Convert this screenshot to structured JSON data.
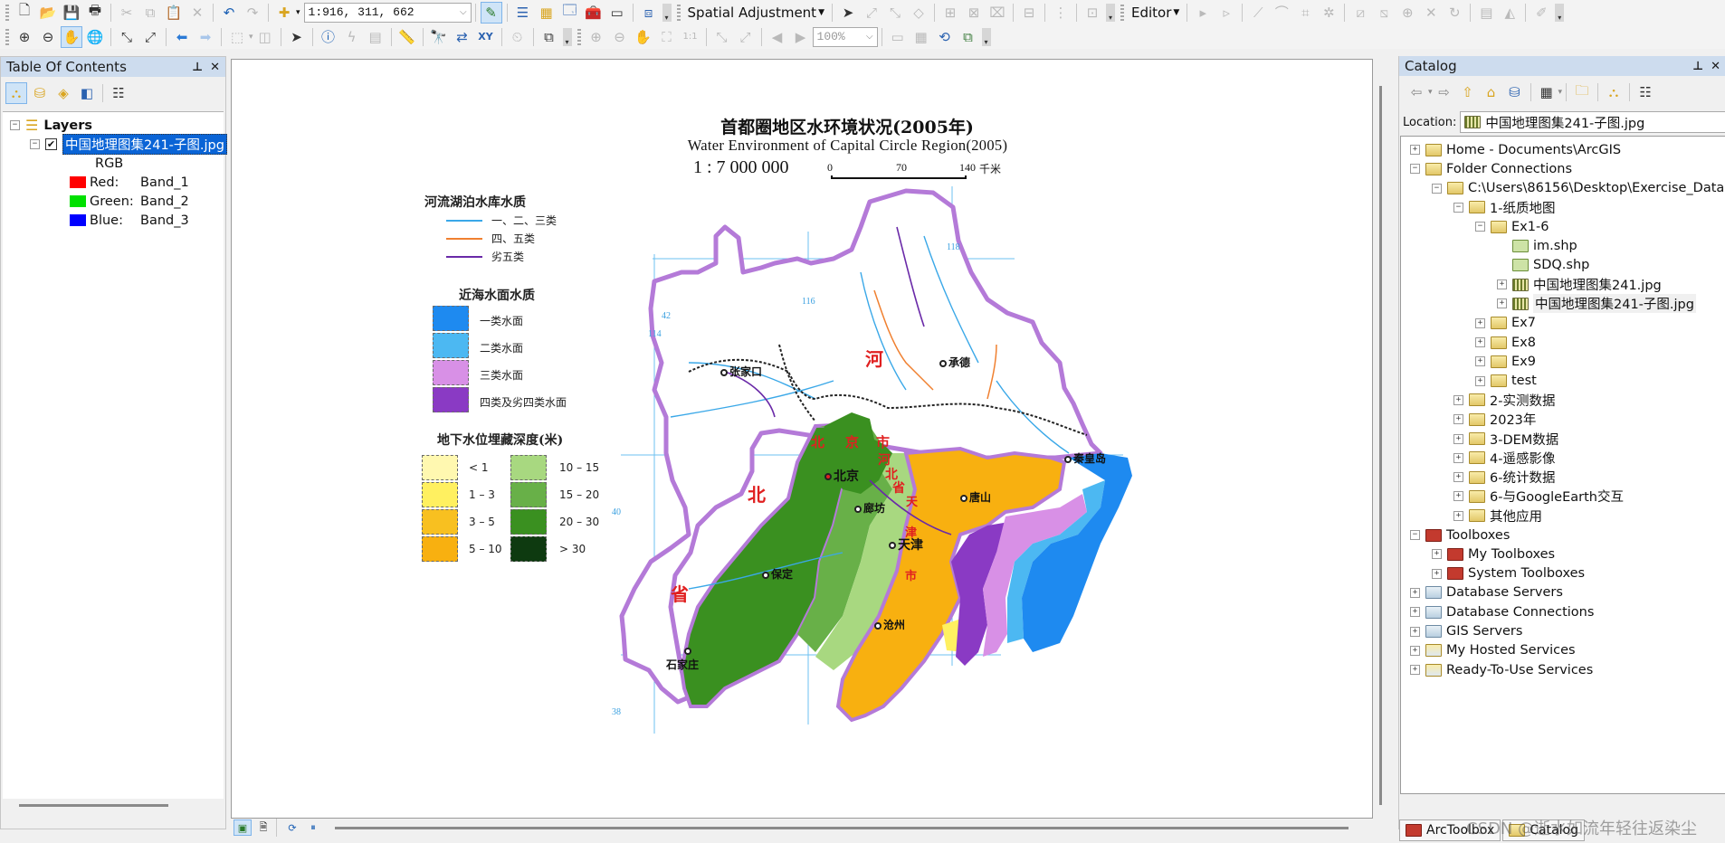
{
  "toolbar1": {
    "scale_value": "1:916, 311, 662",
    "spatial_adjustment_label": "Spatial Adjustment",
    "editor_label": "Editor",
    "icons": [
      "new-document",
      "open-folder",
      "save",
      "print",
      "cut",
      "copy",
      "paste",
      "delete",
      "undo",
      "redo",
      "add-data",
      "scale-combo",
      "editor-toolbar",
      "table-of-contents",
      "catalog",
      "search-window",
      "arctoolbox",
      "python",
      "modelbuilder"
    ]
  },
  "toolbar2": {
    "zoom_percent": "100%"
  },
  "toc": {
    "title": "Table Of Contents",
    "root_label": "Layers",
    "layer_name": "中国地理图集241-子图.jpg",
    "layer_checked": true,
    "renderer": "RGB",
    "bands": [
      {
        "label": "Red:",
        "band": "Band_1",
        "color": "#ff0000"
      },
      {
        "label": "Green:",
        "band": "Band_2",
        "color": "#00e000"
      },
      {
        "label": "Blue:",
        "band": "Band_3",
        "color": "#0000ff"
      }
    ]
  },
  "map": {
    "title_zh": "首都圈地区水环境状况(2005年)",
    "title_en": "Water Environment of Capital Circle Region(2005)",
    "scale_text": "1 : 7 000 000",
    "scalebar": {
      "ticks": [
        "0",
        "70",
        "140"
      ],
      "unit": "千米"
    },
    "legend": {
      "rivers": {
        "title": "河流湖泊水库水质",
        "items": [
          {
            "label": "一、二、三类",
            "color": "#3aa8e8"
          },
          {
            "label": "四、五类",
            "color": "#f08030"
          },
          {
            "label": "劣五类",
            "color": "#6a2aa8"
          }
        ]
      },
      "sea": {
        "title": "近海水面水质",
        "items": [
          {
            "label": "一类水面",
            "color": "#1e8af0"
          },
          {
            "label": "二类水面",
            "color": "#4cb8f2"
          },
          {
            "label": "三类水面",
            "color": "#d890e6"
          },
          {
            "label": "四类及劣四类水面",
            "color": "#8a3ac4"
          }
        ]
      },
      "groundwater": {
        "title": "地下水位埋藏深度(米)",
        "items": [
          {
            "label": "< 1",
            "color": "#fff8b0"
          },
          {
            "label": "1 – 3",
            "color": "#fff060"
          },
          {
            "label": "3 – 5",
            "color": "#f8c020"
          },
          {
            "label": "5 – 10",
            "color": "#f8b010"
          },
          {
            "label": "10 – 15",
            "color": "#a8d880"
          },
          {
            "label": "15 – 20",
            "color": "#68b048"
          },
          {
            "label": "20 – 30",
            "color": "#3a9020"
          },
          {
            "label": "> 30",
            "color": "#0e3a10"
          }
        ]
      }
    },
    "places": [
      {
        "name": "张家口"
      },
      {
        "name": "承德"
      },
      {
        "name": "北京"
      },
      {
        "name": "廊坊"
      },
      {
        "name": "唐山"
      },
      {
        "name": "秦皇岛"
      },
      {
        "name": "天津"
      },
      {
        "name": "保定"
      },
      {
        "name": "沧州"
      },
      {
        "name": "石家庄"
      }
    ],
    "region_labels": [
      "河",
      "北",
      "省",
      "北",
      "京",
      "市",
      "河",
      "北",
      "省",
      "天",
      "津",
      "市"
    ],
    "grid_labels": {
      "lon": [
        "114",
        "116",
        "118"
      ],
      "lat": [
        "38",
        "40",
        "42"
      ]
    }
  },
  "map_status": {
    "data_view_icon": "data-view",
    "layout_view_icon": "layout-view",
    "refresh_icon": "refresh",
    "pause_icon": "pause"
  },
  "catalog": {
    "title": "Catalog",
    "location_label": "Location:",
    "location_value": "中国地理图集241-子图.jpg",
    "tree": [
      {
        "level": 0,
        "expander": "+",
        "icon": "folder-home",
        "label": "Home - Documents\\ArcGIS"
      },
      {
        "level": 0,
        "expander": "-",
        "icon": "folder-connections",
        "label": "Folder Connections"
      },
      {
        "level": 1,
        "expander": "-",
        "icon": "folder",
        "label": "C:\\Users\\86156\\Desktop\\Exercise_Data"
      },
      {
        "level": 2,
        "expander": "-",
        "icon": "folder",
        "label": "1-纸质地图"
      },
      {
        "level": 3,
        "expander": "-",
        "icon": "folder",
        "label": "Ex1-6"
      },
      {
        "level": 4,
        "expander": "",
        "icon": "shapefile",
        "label": "im.shp"
      },
      {
        "level": 4,
        "expander": "",
        "icon": "shapefile",
        "label": "SDQ.shp"
      },
      {
        "level": 4,
        "expander": "+",
        "icon": "raster",
        "label": "中国地理图集241.jpg"
      },
      {
        "level": 4,
        "expander": "+",
        "icon": "raster",
        "label": "中国地理图集241-子图.jpg",
        "highlighted": true
      },
      {
        "level": 3,
        "expander": "+",
        "icon": "folder",
        "label": "Ex7"
      },
      {
        "level": 3,
        "expander": "+",
        "icon": "folder",
        "label": "Ex8"
      },
      {
        "level": 3,
        "expander": "+",
        "icon": "folder",
        "label": "Ex9"
      },
      {
        "level": 3,
        "expander": "+",
        "icon": "folder",
        "label": "test"
      },
      {
        "level": 2,
        "expander": "+",
        "icon": "folder",
        "label": "2-实测数据"
      },
      {
        "level": 2,
        "expander": "+",
        "icon": "folder",
        "label": "2023年"
      },
      {
        "level": 2,
        "expander": "+",
        "icon": "folder",
        "label": "3-DEM数据"
      },
      {
        "level": 2,
        "expander": "+",
        "icon": "folder",
        "label": "4-遥感影像"
      },
      {
        "level": 2,
        "expander": "+",
        "icon": "folder",
        "label": "6-统计数据"
      },
      {
        "level": 2,
        "expander": "+",
        "icon": "folder",
        "label": "6-与GoogleEarth交互"
      },
      {
        "level": 2,
        "expander": "+",
        "icon": "folder",
        "label": "其他应用"
      },
      {
        "level": 0,
        "expander": "-",
        "icon": "toolbox",
        "label": "Toolboxes"
      },
      {
        "level": 1,
        "expander": "+",
        "icon": "toolbox",
        "label": "My Toolboxes"
      },
      {
        "level": 1,
        "expander": "+",
        "icon": "toolbox",
        "label": "System Toolboxes"
      },
      {
        "level": 0,
        "expander": "+",
        "icon": "server",
        "label": "Database Servers"
      },
      {
        "level": 0,
        "expander": "+",
        "icon": "server",
        "label": "Database Connections"
      },
      {
        "level": 0,
        "expander": "+",
        "icon": "server",
        "label": "GIS Servers"
      },
      {
        "level": 0,
        "expander": "+",
        "icon": "cloud",
        "label": "My Hosted Services"
      },
      {
        "level": 0,
        "expander": "+",
        "icon": "cloud",
        "label": "Ready-To-Use Services"
      }
    ],
    "tabs": [
      {
        "label": "ArcToolbox"
      },
      {
        "label": "Catalog"
      }
    ]
  },
  "watermark": "CSDN @逝水如流年轻往返染尘"
}
